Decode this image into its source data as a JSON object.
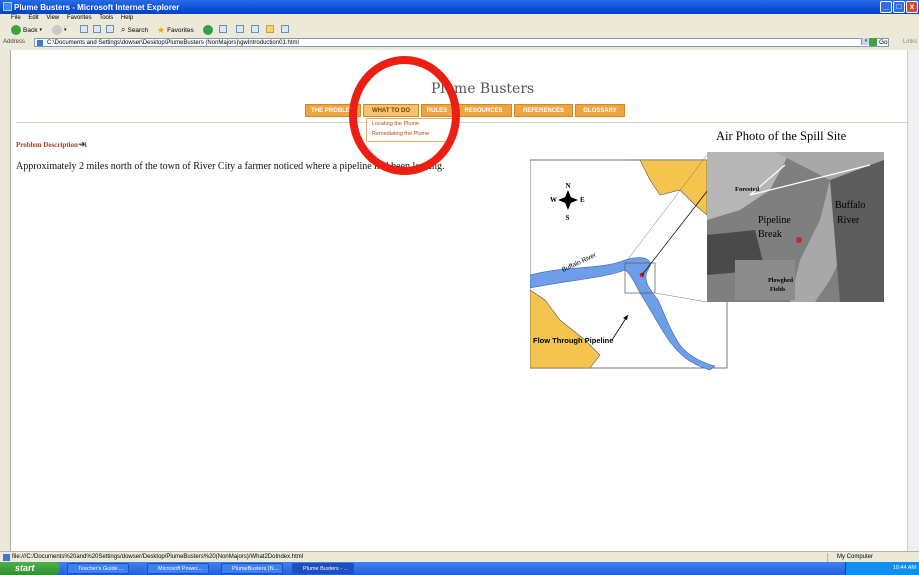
{
  "window": {
    "title": "Plume Busters - Microsoft Internet Explorer",
    "minimize": "_",
    "maximize": "□",
    "close": "x"
  },
  "menu": [
    "File",
    "Edit",
    "View",
    "Favorites",
    "Tools",
    "Help"
  ],
  "toolbar": {
    "back": "Back",
    "search": "Search",
    "favorites": "Favorites"
  },
  "address": {
    "label": "Address",
    "url": "C:\\Documents and Settings\\dowser\\Desktop\\PlumeBusters (NonMajors)\\gwIntroduction01.html",
    "go": "Go",
    "links": "Links"
  },
  "site": {
    "title": "Plume Busters",
    "nav": [
      "THE PROBLEM",
      "WHAT TO DO",
      "RULES",
      "RESOURCES",
      "REFERENCES",
      "GLOSSARY"
    ],
    "submenu": [
      "Locating the Plume",
      "Remediating the Plume"
    ]
  },
  "content": {
    "heading": "Problem Description - 1",
    "arrow": "➜",
    "text": "Approximately 2 miles north of the town of River City a farmer noticed where a pipeline had been leaking.",
    "figure_caption": "Air Photo of the Spill Site",
    "map_labels": {
      "compass_n": "N",
      "compass_s": "S",
      "compass_e": "E",
      "compass_w": "W",
      "river": "Buffalo River",
      "flow": "Flow Through Pipeline",
      "forested": "Forested",
      "pipeline_break_1": "Pipeline",
      "pipeline_break_2": "Break",
      "buffalo_1": "Buffalo",
      "buffalo_2": "River",
      "plowed_1": "Plowghed",
      "plowed_2": "Fields"
    }
  },
  "status": {
    "url": "file:///C:/Documents%20and%20Settings/dowser/Desktop/PlumeBusters%20(NonMajors)/What2DoIndex.html",
    "zone": "My Computer"
  },
  "taskbar": {
    "start": "start",
    "tasks": [
      "Teacher's Guide ...",
      "Microsoft Power...",
      "PlumeBusters (N...",
      "Plume Busters - ..."
    ],
    "clock": "10:44 AM"
  },
  "colors": {
    "nav_orange": "#eea441",
    "highlight_red": "#ec1f12",
    "heading_rust": "#a93b1e",
    "river_blue": "#6f9ee9",
    "land_yellow": "#f5c44f"
  }
}
